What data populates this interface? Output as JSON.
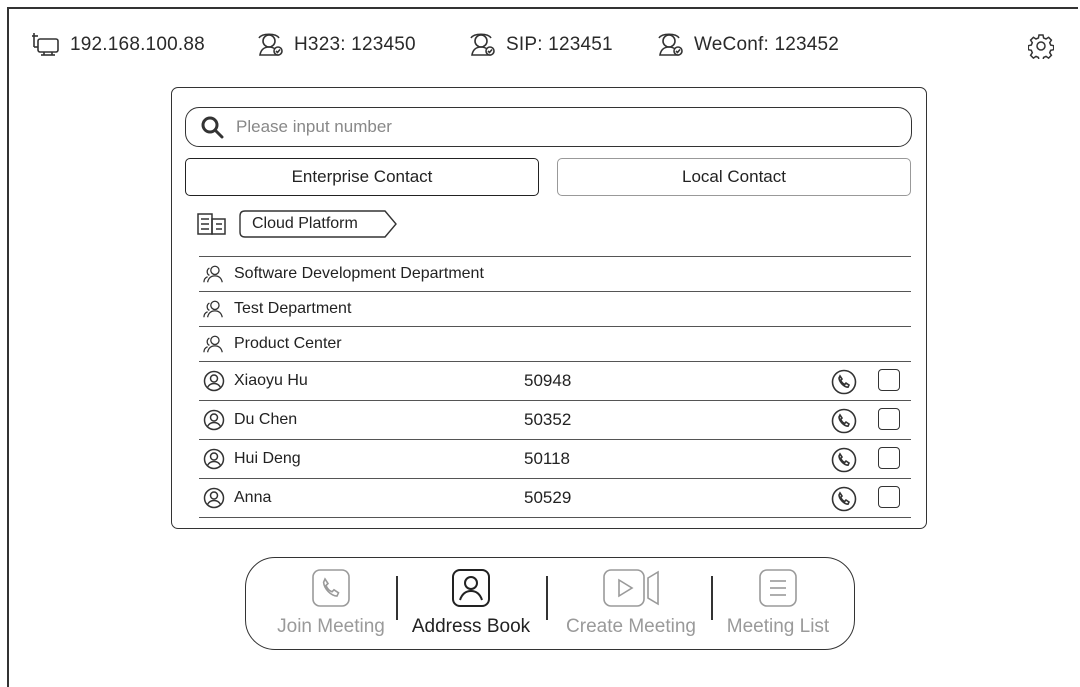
{
  "status_bar": {
    "ip": "192.168.100.88",
    "h323": "H323: 123450",
    "sip": "SIP: 123451",
    "weconf": "WeConf: 123452"
  },
  "search": {
    "placeholder": "Please input number"
  },
  "tabs": {
    "enterprise": "Enterprise Contact",
    "local": "Local Contact"
  },
  "breadcrumb": {
    "label": "Cloud Platform"
  },
  "groups": [
    {
      "name": "Software Development Department"
    },
    {
      "name": "Test Department"
    },
    {
      "name": "Product Center"
    }
  ],
  "contacts": [
    {
      "name": "Xiaoyu Hu",
      "number": "50948"
    },
    {
      "name": "Du Chen",
      "number": "50352"
    },
    {
      "name": "Hui Deng",
      "number": "50118"
    },
    {
      "name": "Anna",
      "number": "50529"
    }
  ],
  "nav": {
    "join": "Join Meeting",
    "address": "Address Book",
    "create": "Create Meeting",
    "list": "Meeting List"
  },
  "colors": {
    "active": "#222222",
    "inactive": "#9a9a9a",
    "border": "#333333"
  }
}
